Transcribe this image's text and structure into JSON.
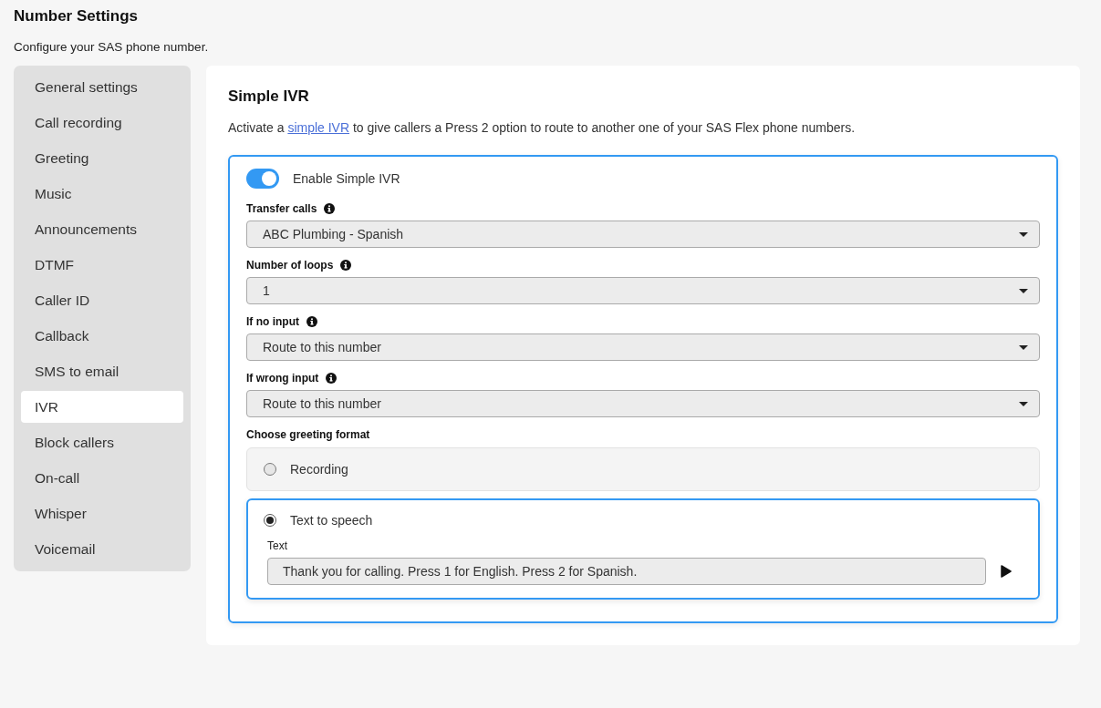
{
  "page": {
    "title": "Number Settings",
    "subtitle": "Configure your SAS phone number."
  },
  "sidebar": {
    "items": [
      {
        "label": "General settings",
        "selected": false
      },
      {
        "label": "Call recording",
        "selected": false
      },
      {
        "label": "Greeting",
        "selected": false
      },
      {
        "label": "Music",
        "selected": false
      },
      {
        "label": "Announcements",
        "selected": false
      },
      {
        "label": "DTMF",
        "selected": false
      },
      {
        "label": "Caller ID",
        "selected": false
      },
      {
        "label": "Callback",
        "selected": false
      },
      {
        "label": "SMS to email",
        "selected": false
      },
      {
        "label": "IVR",
        "selected": true
      },
      {
        "label": "Block callers",
        "selected": false
      },
      {
        "label": "On-call",
        "selected": false
      },
      {
        "label": "Whisper",
        "selected": false
      },
      {
        "label": "Voicemail",
        "selected": false
      }
    ]
  },
  "section": {
    "title": "Simple IVR",
    "description": {
      "before": "Activate a ",
      "link": "simple IVR",
      "after": " to give callers a Press 2 option to route to another one of your SAS Flex phone numbers."
    }
  },
  "ivr": {
    "toggle": {
      "label": "Enable Simple IVR",
      "on": true
    },
    "fields": [
      {
        "label": "Transfer calls",
        "value": "ABC Plumbing - Spanish"
      },
      {
        "label": "Number of loops",
        "value": "1"
      },
      {
        "label": "If no input",
        "value": "Route to this number"
      },
      {
        "label": "If wrong input",
        "value": "Route to this number"
      }
    ],
    "greeting": {
      "label": "Choose greeting format",
      "options": [
        {
          "label": "Recording",
          "selected": false
        },
        {
          "label": "Text to speech",
          "selected": true,
          "text_label": "Text",
          "text_value": "Thank you for calling. Press 1 for English. Press 2 for Spanish."
        }
      ]
    }
  }
}
